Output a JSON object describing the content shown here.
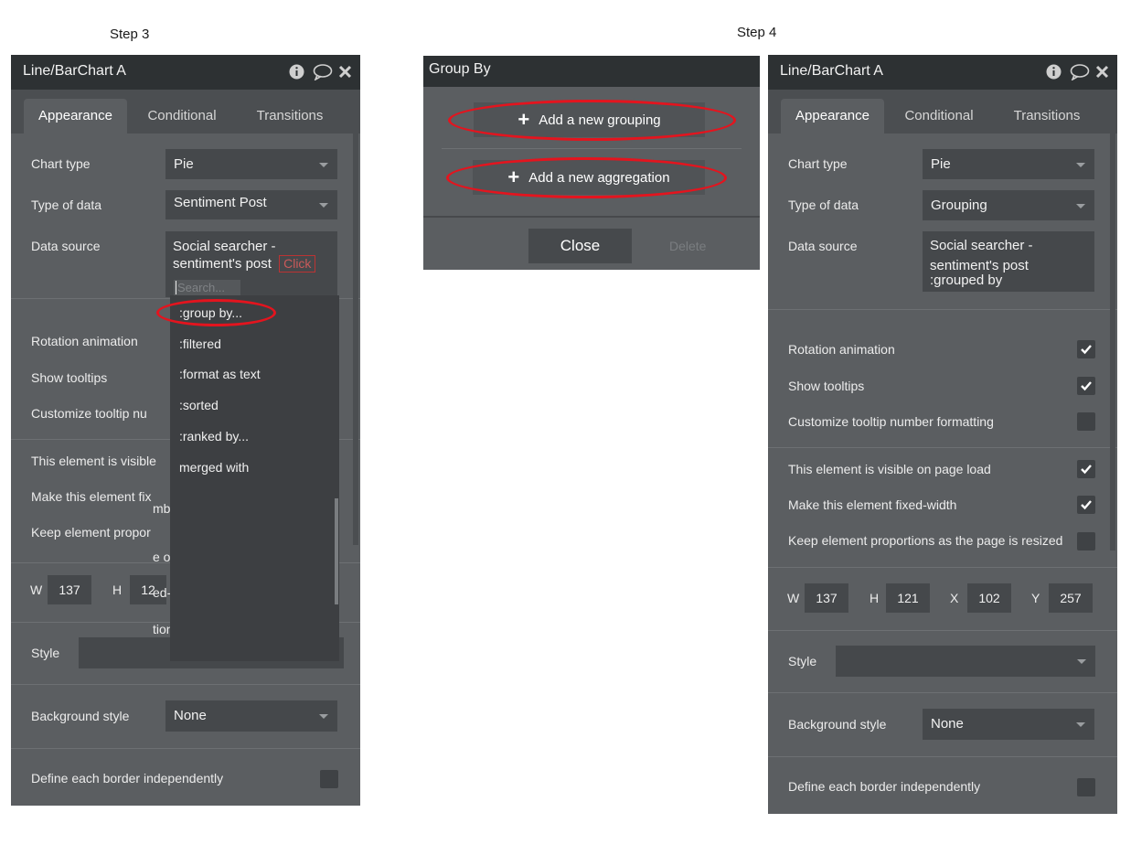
{
  "steps": {
    "left": "Step 3",
    "right": "Step 4"
  },
  "left_panel": {
    "title": "Line/BarChart A",
    "tabs": [
      "Appearance",
      "Conditional",
      "Transitions"
    ],
    "chart_type_label": "Chart type",
    "chart_type_value": "Pie",
    "type_of_data_label": "Type of data",
    "type_of_data_value": "Sentiment Post",
    "data_source_label": "Data source",
    "data_source_line1": "Social searcher -",
    "data_source_line2": "sentiment's post",
    "click_badge": "Click",
    "search_placeholder": "Search...",
    "menu_items": [
      ":group by...",
      ":filtered",
      ":format as text",
      ":sorted",
      ":ranked by...",
      " merged with"
    ],
    "rotation_label": "Rotation animation",
    "tooltips_label": "Show tooltips",
    "customize_label": "Customize tooltip nu",
    "visible_label": "This element is visible",
    "fixed_label": "Make this element fix",
    "keep_label": "Keep element propor",
    "fragments": [
      "mb",
      "e or",
      "ed-",
      "tion"
    ],
    "w_label": "W",
    "w_value": "137",
    "h_label": "H",
    "h_value": "12",
    "style_label": "Style",
    "bg_style_label": "Background style",
    "bg_style_value": "None",
    "border_label": "Define each border independently"
  },
  "group_by": {
    "title": "Group By",
    "add_grouping": "Add a new grouping",
    "add_aggregation": "Add a new aggregation",
    "close": "Close",
    "delete": "Delete"
  },
  "right_panel": {
    "title": "Line/BarChart A",
    "tabs": [
      "Appearance",
      "Conditional",
      "Transitions"
    ],
    "chart_type_label": "Chart type",
    "chart_type_value": "Pie",
    "type_of_data_label": "Type of data",
    "type_of_data_value": "Grouping",
    "data_source_label": "Data source",
    "data_source_line1": "Social searcher -",
    "data_source_line2": "sentiment's post",
    "data_source_line3": ":grouped by",
    "rotation_label": "Rotation animation",
    "rotation_checked": true,
    "tooltips_label": "Show tooltips",
    "tooltips_checked": true,
    "customize_label": "Customize tooltip number formatting",
    "customize_checked": false,
    "visible_label": "This element is visible on page load",
    "visible_checked": true,
    "fixed_label": "Make this element fixed-width",
    "fixed_checked": true,
    "keep_label": "Keep element proportions as the page is resized",
    "keep_checked": false,
    "w_label": "W",
    "w_value": "137",
    "h_label": "H",
    "h_value": "121",
    "x_label": "X",
    "x_value": "102",
    "y_label": "Y",
    "y_value": "257",
    "style_label": "Style",
    "bg_style_label": "Background style",
    "bg_style_value": "None",
    "border_label": "Define each border independently",
    "border_checked": false
  },
  "colors": {
    "panel": "#5b5e61",
    "header": "#2d3133",
    "highlight": "#e4141e"
  }
}
